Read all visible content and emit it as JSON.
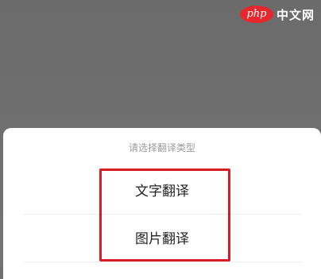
{
  "watermark": {
    "logo_text": "php",
    "site_text": "中文网"
  },
  "sheet": {
    "title": "请选择翻译类型",
    "options": [
      {
        "label": "文字翻译"
      },
      {
        "label": "图片翻译"
      }
    ]
  },
  "colors": {
    "backdrop": "#6f6f6f",
    "sheet": "#ffffff",
    "highlight": "#d81e24",
    "title_text": "#9b9b9b",
    "option_text": "#222222"
  }
}
